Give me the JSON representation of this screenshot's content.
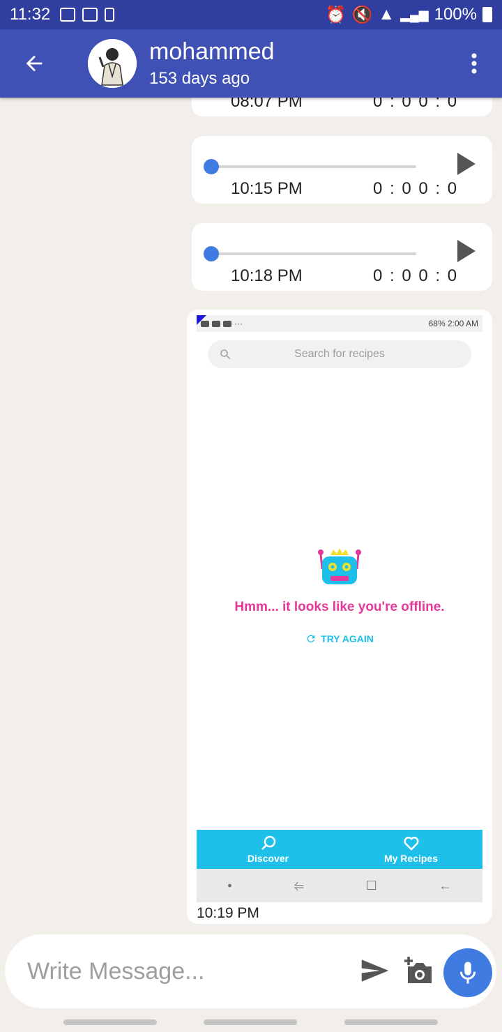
{
  "status_bar": {
    "time": "11:32",
    "battery": "100%"
  },
  "header": {
    "contact_name": "mohammed",
    "last_seen": "153 days ago"
  },
  "messages": {
    "audio": [
      {
        "time": "08:07 PM",
        "duration": "0 : 0  0 : 0"
      },
      {
        "time": "10:15 PM",
        "duration": "0 : 0  0 : 0"
      },
      {
        "time": "10:18 PM",
        "duration": "0 : 0  0 : 0"
      }
    ],
    "image": {
      "time": "10:19 PM",
      "screenshot": {
        "status_right": "68%  2:00 AM",
        "search_placeholder": "Search for recipes",
        "offline_message": "Hmm... it looks like you're offline.",
        "try_again": "TRY AGAIN",
        "nav_discover": "Discover",
        "nav_my_recipes": "My Recipes"
      }
    }
  },
  "composer": {
    "placeholder": "Write Message..."
  },
  "colors": {
    "status_bar": "#303f9f",
    "app_bar": "#3f51b5",
    "accent": "#3f7be0",
    "chat_bg": "#f2efea",
    "offline_pink": "#e4389a",
    "recipes_cyan": "#1ec0ea"
  },
  "icons": [
    "back-arrow-icon",
    "more-vert-icon",
    "play-icon",
    "search-icon",
    "refresh-icon",
    "send-icon",
    "add-photo-icon",
    "mic-icon"
  ]
}
